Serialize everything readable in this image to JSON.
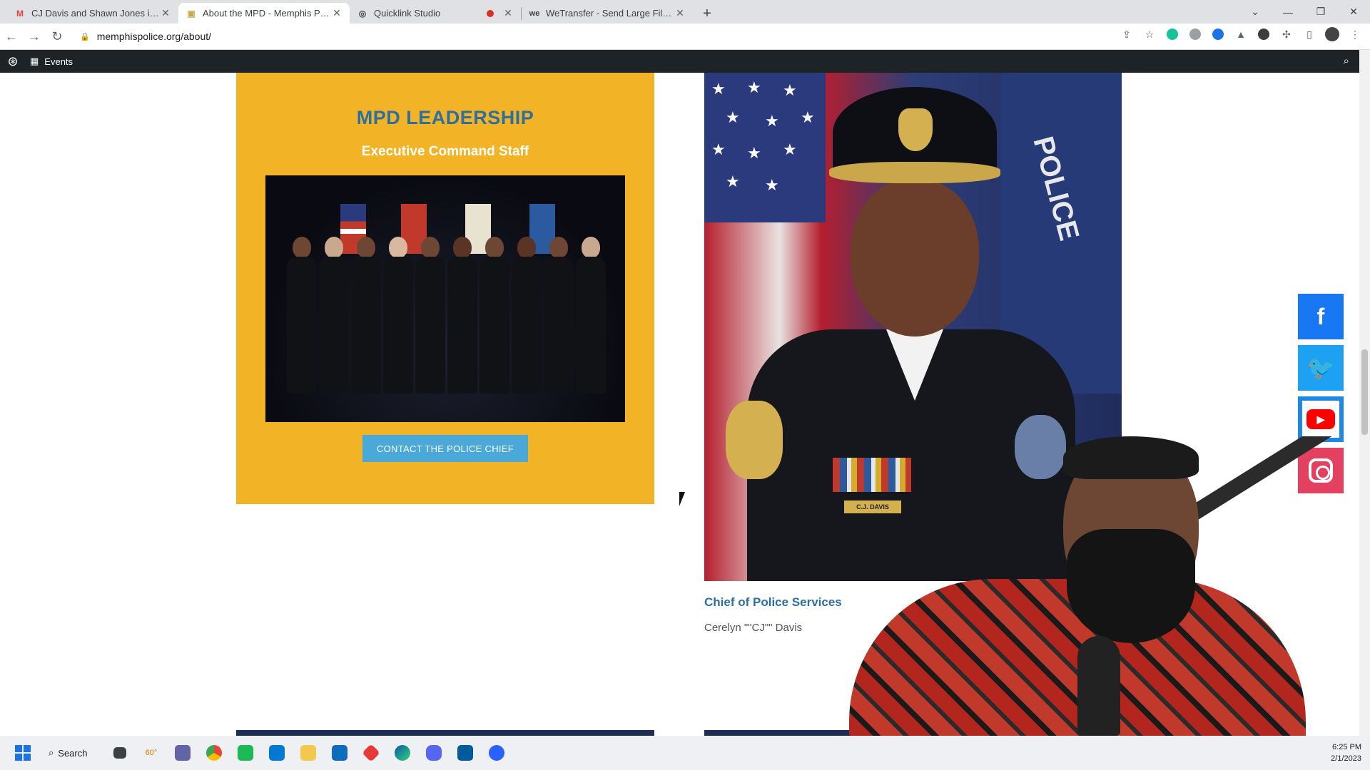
{
  "browser": {
    "tabs": [
      {
        "title": "CJ Davis and Shawn Jones inform",
        "favicon": "M",
        "favicon_color": "#ea4335",
        "active": false
      },
      {
        "title": "About the MPD - Memphis Police",
        "favicon": "▣",
        "favicon_color": "#c9a74a",
        "active": true
      },
      {
        "title": "Quicklink Studio",
        "favicon": "◎",
        "favicon_color": "#202124",
        "active": false,
        "recording": true
      },
      {
        "title": "WeTransfer - Send Large Files &",
        "favicon": "we",
        "favicon_color": "#202124",
        "active": false
      }
    ],
    "new_tab_label": "+",
    "url": "memphispolice.org/about/"
  },
  "site_bar": {
    "events_label": "Events"
  },
  "leadership": {
    "title": "MPD LEADERSHIP",
    "subtitle": "Executive Command Staff",
    "contact_button": "CONTACT THE POLICE CHIEF"
  },
  "chief": {
    "role": "Chief of Police Services",
    "name": "Cerelyn \"\"CJ\"\" Davis",
    "nameplate": "C.J. DAVIS",
    "emblem_text": "POLICE"
  },
  "social": {
    "facebook": "f",
    "twitter": "🐦",
    "youtube": "▶",
    "instagram": ""
  },
  "taskbar": {
    "search_label": "Search",
    "weather": "60°",
    "time": "6:25 PM",
    "date": "2/1/2023"
  },
  "colors": {
    "leadership_bg": "#f3b327",
    "leadership_title": "#2e6f9e",
    "contact_button_bg": "#4aa9d9",
    "admin_bar": "#1d2327"
  }
}
